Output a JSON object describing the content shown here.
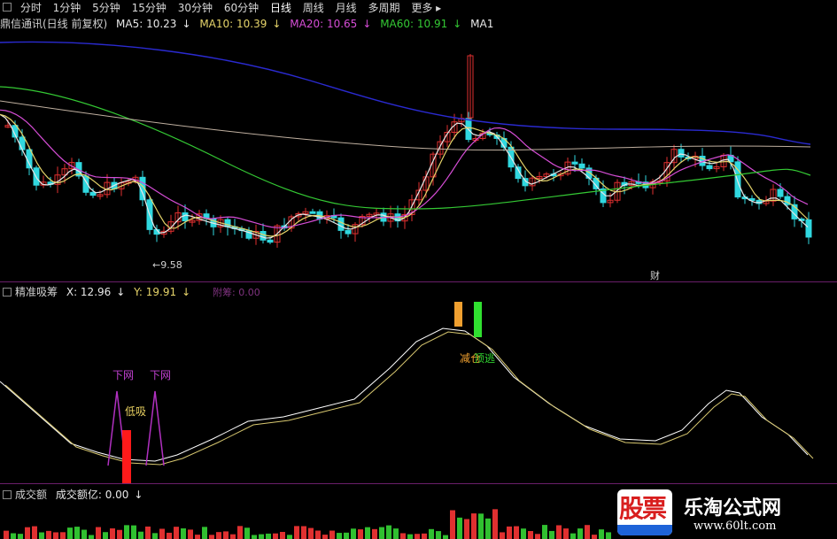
{
  "toolbar": {
    "tabs": [
      "分时",
      "1分钟",
      "5分钟",
      "15分钟",
      "30分钟",
      "60分钟",
      "日线",
      "周线",
      "月线",
      "多周期"
    ],
    "more": "更多",
    "active": "日线"
  },
  "price_panel": {
    "stock_name": "鼎信通讯(日线 前复权)",
    "ma5": "MA5: 10.23",
    "ma10": "MA10: 10.39",
    "ma20": "MA20: 10.65",
    "ma60": "MA60: 10.91",
    "ma_more": "MA1",
    "low_label": "9.58",
    "cai_label": "财"
  },
  "indicator_panel": {
    "name": "精准吸筹",
    "x_value": "X: 12.96",
    "y_value": "Y: 19.91",
    "hidden_label": "附筹: 0.00",
    "labels": {
      "xiawang_1": "下网",
      "xiawang_2": "下网",
      "dixi": "低吸",
      "dingtao": "顶逃",
      "jiancang": "减仓"
    }
  },
  "volume_panel": {
    "name": "成交额",
    "value": "成交额亿: 0.00"
  },
  "watermark": {
    "logo_text": "股票",
    "title": "乐淘公式网",
    "url": "www.60lt.com"
  },
  "colors": {
    "up": "#e03030",
    "down": "#30d8e0",
    "ma5": "#e8e8e8",
    "ma10": "#e6d46a",
    "ma20": "#d64dd6",
    "ma60": "#34c934",
    "ma120": "#2a2ad0",
    "ma250": "#c0b0a0",
    "signal_red": "#ff1a1a",
    "signal_orange": "#f0a030",
    "signal_green": "#30e030",
    "divider": "#6a1f6a"
  }
}
